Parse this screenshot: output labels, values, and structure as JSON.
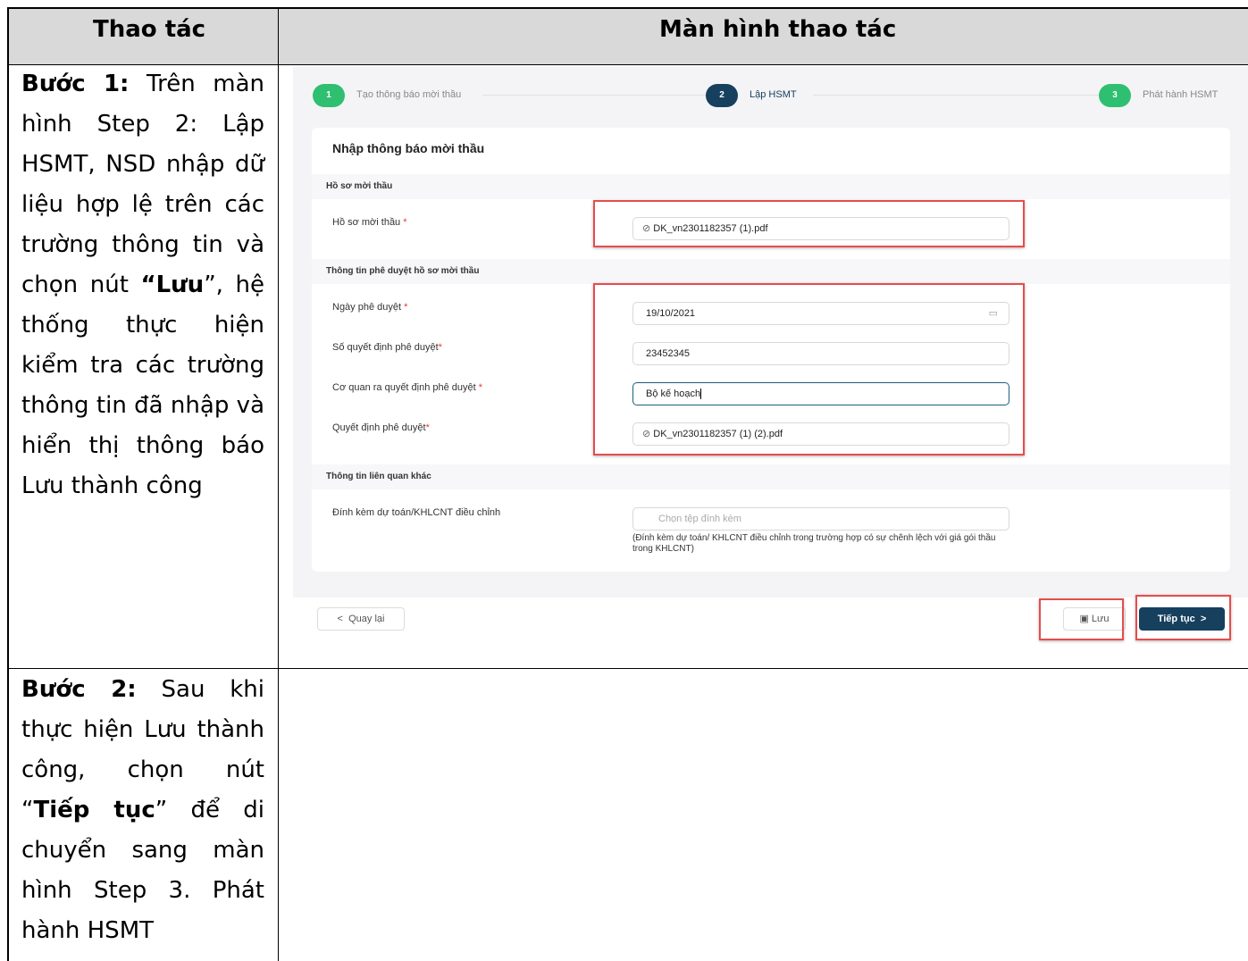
{
  "table": {
    "header_left": "Thao tác",
    "header_right": "Màn hình thao tác"
  },
  "step1": {
    "prefix": "Bước 1:",
    "text_a": " Trên màn hình Step 2: Lập HSMT, NSD nhập dữ liệu hợp lệ trên các trường thông tin và chọn nút ",
    "bold_save": "“Lưu",
    "text_b": "”, hệ thống thực hiện kiểm tra các trường thông tin đã nhập và hiển thị thông báo Lưu thành công"
  },
  "step2": {
    "prefix": "Bước 2:",
    "text_a": " Sau khi thực hiện Lưu thành công, chọn nút “",
    "bold_continue": "Tiếp tục",
    "text_b": "” để di chuyển sang màn hình Step 3. Phát hành HSMT"
  },
  "stepper": {
    "steps": [
      {
        "num": "1",
        "label": "Tạo thông báo mời thầu",
        "color": "#2fbf71"
      },
      {
        "num": "2",
        "label": "Lập HSMT",
        "color": "#16405e"
      },
      {
        "num": "3",
        "label": "Phát hành HSMT",
        "color": "#2fbf71"
      }
    ]
  },
  "form": {
    "title": "Nhập thông báo mời thầu",
    "section1": "Hồ sơ mời thầu",
    "hsmt_label": "Hồ sơ mời thầu",
    "hsmt_file": "DK_vn2301182357 (1).pdf",
    "section2": "Thông tin phê duyệt hồ sơ mời thầu",
    "approve_date_label": "Ngày phê duyệt",
    "approve_date_value": "19/10/2021",
    "decision_no_label": "Số quyết định phê duyệt",
    "decision_no_value": "23452345",
    "agency_label": "Cơ quan ra quyết định phê duyệt",
    "agency_value": "Bộ kế hoạch",
    "decision_file_label": "Quyết định phê duyệt",
    "decision_file_value": "DK_vn2301182357 (1) (2).pdf",
    "section3": "Thông tin liên quan khác",
    "attach_label": "Đính kèm dự toán/KHLCNT điều chỉnh",
    "attach_placeholder": "Chọn tệp đính kèm",
    "attach_hint": "(Đính kèm dự toán/ KHLCNT điều chỉnh trong trường hợp có sự chênh lệch với giá gói thầu trong KHLCNT)",
    "required_mark": "*"
  },
  "actions": {
    "back_label": "Quay lại",
    "save_label": "Lưu",
    "continue_label": "Tiếp tục"
  }
}
